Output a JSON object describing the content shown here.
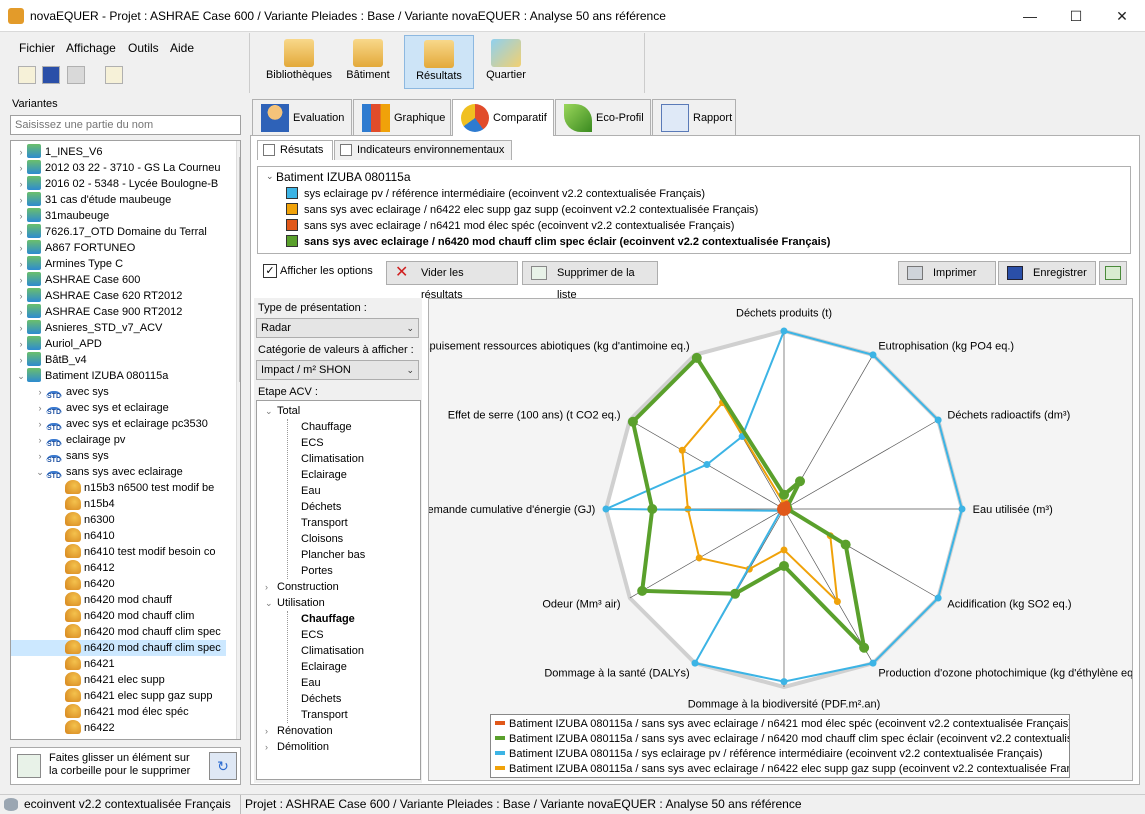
{
  "window": {
    "title": "novaEQUER -  Projet : ASHRAE Case 600 / Variante Pleiades : Base / Variante novaEQUER : Analyse 50 ans référence",
    "minimize": "—",
    "maximize": "☐",
    "close": "✕"
  },
  "menu": [
    "Fichier",
    "Affichage",
    "Outils",
    "Aide"
  ],
  "big_toolbar": [
    {
      "label": "Bibliothèques",
      "icon": "folder-library-icon"
    },
    {
      "label": "Bâtiment",
      "icon": "folder-building-icon"
    },
    {
      "label": "Résultats",
      "icon": "folder-results-icon",
      "active": true
    },
    {
      "label": "Quartier",
      "icon": "district-icon"
    }
  ],
  "left_panel": {
    "header": "Variantes",
    "search_placeholder": "Saisissez une partie du nom",
    "tree": [
      {
        "label": "1_INES_V6",
        "level": 0,
        "icon": "building",
        "arrow": "›"
      },
      {
        "label": "2012 03 22 - 3710 - GS La Courneu",
        "level": 0,
        "icon": "building",
        "arrow": "›"
      },
      {
        "label": "2016 02 - 5348 - Lycée Boulogne-B",
        "level": 0,
        "icon": "building",
        "arrow": "›"
      },
      {
        "label": "31 cas d'étude maubeuge",
        "level": 0,
        "icon": "building",
        "arrow": "›"
      },
      {
        "label": "31maubeuge",
        "level": 0,
        "icon": "building",
        "arrow": "›"
      },
      {
        "label": "7626.17_OTD Domaine du Terral",
        "level": 0,
        "icon": "building",
        "arrow": "›"
      },
      {
        "label": "A867 FORTUNEO",
        "level": 0,
        "icon": "building",
        "arrow": "›"
      },
      {
        "label": "Armines Type C",
        "level": 0,
        "icon": "building",
        "arrow": "›"
      },
      {
        "label": "ASHRAE Case 600",
        "level": 0,
        "icon": "building",
        "arrow": "›"
      },
      {
        "label": "ASHRAE Case 620 RT2012",
        "level": 0,
        "icon": "building",
        "arrow": "›"
      },
      {
        "label": "ASHRAE Case 900 RT2012",
        "level": 0,
        "icon": "building",
        "arrow": "›"
      },
      {
        "label": "Asnieres_STD_v7_ACV",
        "level": 0,
        "icon": "building",
        "arrow": "›"
      },
      {
        "label": "Auriol_APD",
        "level": 0,
        "icon": "building",
        "arrow": "›"
      },
      {
        "label": "BâtB_v4",
        "level": 0,
        "icon": "building",
        "arrow": "›"
      },
      {
        "label": "Batiment IZUBA 080115a",
        "level": 0,
        "icon": "building",
        "arrow": "⌄"
      },
      {
        "label": "avec sys",
        "level": 1,
        "icon": "std",
        "arrow": "›"
      },
      {
        "label": "avec sys et eclairage",
        "level": 1,
        "icon": "std",
        "arrow": "›"
      },
      {
        "label": "avec sys et eclairage pc3530",
        "level": 1,
        "icon": "std",
        "arrow": "›"
      },
      {
        "label": "eclairage pv",
        "level": 1,
        "icon": "std",
        "arrow": "›"
      },
      {
        "label": "sans sys",
        "level": 1,
        "icon": "std",
        "arrow": "›"
      },
      {
        "label": "sans sys avec eclairage",
        "level": 1,
        "icon": "std",
        "arrow": "⌄"
      },
      {
        "label": "n15b3 n6500 test modif be",
        "level": 2,
        "icon": "variant",
        "arrow": ""
      },
      {
        "label": "n15b4",
        "level": 2,
        "icon": "variant",
        "arrow": ""
      },
      {
        "label": "n6300",
        "level": 2,
        "icon": "variant",
        "arrow": ""
      },
      {
        "label": "n6410",
        "level": 2,
        "icon": "variant",
        "arrow": ""
      },
      {
        "label": "n6410 test modif besoin co",
        "level": 2,
        "icon": "variant",
        "arrow": ""
      },
      {
        "label": "n6412",
        "level": 2,
        "icon": "variant",
        "arrow": ""
      },
      {
        "label": "n6420",
        "level": 2,
        "icon": "variant",
        "arrow": ""
      },
      {
        "label": "n6420 mod chauff",
        "level": 2,
        "icon": "variant",
        "arrow": ""
      },
      {
        "label": "n6420 mod chauff clim",
        "level": 2,
        "icon": "variant",
        "arrow": ""
      },
      {
        "label": "n6420 mod chauff clim spec",
        "level": 2,
        "icon": "variant",
        "arrow": ""
      },
      {
        "label": "n6420 mod chauff clim spec",
        "level": 2,
        "icon": "variant",
        "arrow": "",
        "selected": true
      },
      {
        "label": "n6421",
        "level": 2,
        "icon": "variant",
        "arrow": ""
      },
      {
        "label": "n6421 elec supp",
        "level": 2,
        "icon": "variant",
        "arrow": ""
      },
      {
        "label": "n6421 elec supp gaz supp",
        "level": 2,
        "icon": "variant",
        "arrow": ""
      },
      {
        "label": "n6421 mod élec spéc",
        "level": 2,
        "icon": "variant",
        "arrow": ""
      },
      {
        "label": "n6422",
        "level": 2,
        "icon": "variant",
        "arrow": ""
      }
    ],
    "trash_hint": "Faites glisser un élément sur la corbeille pour le supprimer"
  },
  "status": {
    "library": "ecoinvent v2.2 contextualisée Français",
    "project": "Projet : ASHRAE Case 600 / Variante Pleiades : Base / Variante novaEQUER : Analyse 50 ans référence"
  },
  "main_tabs": [
    {
      "label": "Evaluation"
    },
    {
      "label": "Graphique"
    },
    {
      "label": "Comparatif",
      "active": true
    },
    {
      "label": "Eco-Profil"
    },
    {
      "label": "Rapport"
    }
  ],
  "sub_tabs": [
    {
      "label": "Résutats",
      "active": true
    },
    {
      "label": "Indicateurs environnementaux"
    }
  ],
  "results_list": {
    "building": "Batiment IZUBA 080115a",
    "items": [
      {
        "label": "sys eclairage pv / référence intermédiaire (ecoinvent v2.2 contextualisée Français)",
        "color": "#3cb4e5",
        "bold": false
      },
      {
        "label": "sans sys avec eclairage / n6422 elec supp gaz supp (ecoinvent v2.2 contextualisée Français)",
        "color": "#f0a20a",
        "bold": false
      },
      {
        "label": "sans sys avec eclairage / n6421 mod élec spéc (ecoinvent v2.2 contextualisée Français)",
        "color": "#e0581a",
        "bold": false
      },
      {
        "label": "sans sys avec eclairage / n6420 mod chauff clim spec éclair (ecoinvent v2.2 contextualisée Français)",
        "color": "#5aa02c",
        "bold": true
      }
    ]
  },
  "actions": {
    "show_options": "Afficher les options",
    "clear": "Vider les résultats",
    "remove": "Supprimer de la liste",
    "print": "Imprimer",
    "save": "Enregistrer"
  },
  "options": {
    "presentation_label": "Type de présentation :",
    "presentation_value": "Radar",
    "category_label": "Catégorie de valeurs à afficher :",
    "category_value": "Impact / m² SHON",
    "stage_label": "Etape ACV :",
    "stages": [
      {
        "label": "Total",
        "level": 0,
        "arrow": "⌄"
      },
      {
        "label": "Chauffage",
        "level": 1
      },
      {
        "label": "ECS",
        "level": 1
      },
      {
        "label": "Climatisation",
        "level": 1
      },
      {
        "label": "Eclairage",
        "level": 1
      },
      {
        "label": "Eau",
        "level": 1
      },
      {
        "label": "Déchets",
        "level": 1
      },
      {
        "label": "Transport",
        "level": 1
      },
      {
        "label": "Cloisons",
        "level": 1
      },
      {
        "label": "Plancher bas",
        "level": 1
      },
      {
        "label": "Portes",
        "level": 1
      },
      {
        "label": "Construction",
        "level": 0,
        "arrow": "›"
      },
      {
        "label": "Utilisation",
        "level": 0,
        "arrow": "⌄"
      },
      {
        "label": "Chauffage",
        "level": 1,
        "bold": true
      },
      {
        "label": "ECS",
        "level": 1
      },
      {
        "label": "Climatisation",
        "level": 1
      },
      {
        "label": "Eclairage",
        "level": 1
      },
      {
        "label": "Eau",
        "level": 1
      },
      {
        "label": "Déchets",
        "level": 1
      },
      {
        "label": "Transport",
        "level": 1
      },
      {
        "label": "Rénovation",
        "level": 0,
        "arrow": "›"
      },
      {
        "label": "Démolition",
        "level": 0,
        "arrow": "›"
      }
    ]
  },
  "chart_data": {
    "type": "radar",
    "axes": [
      "Déchets produits (t)",
      "Eutrophisation (kg PO4 eq.)",
      "Déchets radioactifs (dm³)",
      "Eau utilisée (m³)",
      "Acidification (kg SO2 eq.)",
      "Production d'ozone photochimique (kg d'éthylène eq.)",
      "Dommage à la biodiversité (PDF.m².an)",
      "Dommage à la santé (DALYs)",
      "Odeur (Mm³ air)",
      "Demande cumulative d'énergie (GJ)",
      "Effet de serre (100 ans) (t CO2 eq.)",
      "Epuisement ressources abiotiques (kg d'antimoine eq.)"
    ],
    "rmax": 1.0,
    "grid_levels": 2,
    "legend_position": "bottom",
    "series": [
      {
        "name": "Batiment IZUBA 080115a / sans sys avec eclairage / n6421 mod élec spéc (ecoinvent v2.2 contextualisée Français)",
        "color": "#e0581a",
        "values": [
          0.02,
          0.03,
          0.02,
          0.02,
          0.02,
          0.02,
          0.02,
          0.02,
          0.02,
          0.02,
          0.02,
          0.02
        ]
      },
      {
        "name": "Batiment IZUBA 080115a / sans sys avec eclairage / n6420 mod chauff clim spec éclair (ecoinvent v2.2 contextualisée Français)",
        "color": "#5aa02c",
        "values": [
          0.08,
          0.18,
          0.02,
          0.02,
          0.4,
          0.9,
          0.32,
          0.55,
          0.92,
          0.74,
          0.98,
          0.98
        ]
      },
      {
        "name": "Batiment IZUBA 080115a / sys eclairage pv / référence intermédiaire (ecoinvent v2.2 contextualisée Français)",
        "color": "#3cb4e5",
        "values": [
          1.0,
          1.0,
          1.0,
          1.0,
          1.0,
          1.0,
          0.97,
          1.0,
          0.02,
          1.0,
          0.5,
          0.47
        ]
      },
      {
        "name": "Batiment IZUBA 080115a / sans sys avec eclairage / n6422 elec supp gaz supp (ecoinvent v2.2 contextualisée Français)",
        "color": "#f0a20a",
        "values": [
          0.03,
          0.04,
          0.02,
          0.02,
          0.3,
          0.6,
          0.23,
          0.39,
          0.55,
          0.54,
          0.66,
          0.69
        ]
      }
    ]
  }
}
